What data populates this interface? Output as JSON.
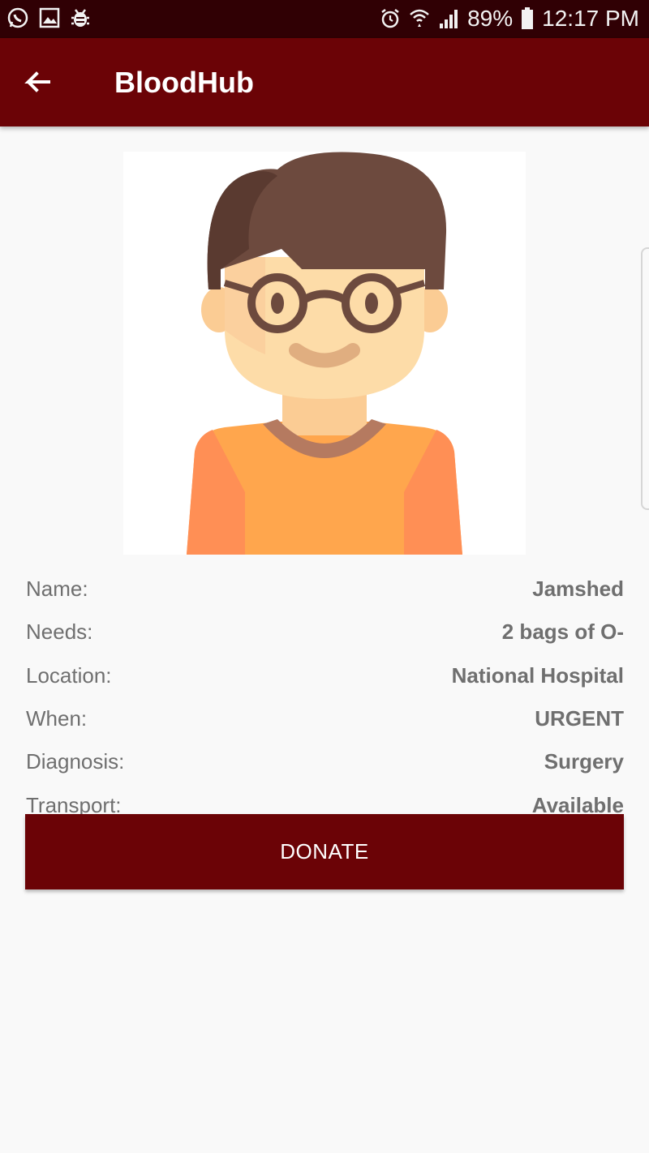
{
  "status_bar": {
    "battery": "89%",
    "time": "12:17 PM",
    "left_icons": [
      "whatsapp-icon",
      "gallery-icon",
      "debug-icon"
    ],
    "right_icons": [
      "alarm-icon",
      "wifi-icon",
      "signal-icon",
      "battery-icon"
    ]
  },
  "app_bar": {
    "title": "BloodHub",
    "back_icon": "arrow-left-icon"
  },
  "avatar": {
    "icon": "user-avatar-glasses",
    "colors": {
      "hair": "#6d4a3e",
      "skin": "#fddca8",
      "shirt": "#ffa64d",
      "collar": "#b57a60"
    }
  },
  "details": {
    "rows": [
      {
        "label": "Name:",
        "value": "Jamshed"
      },
      {
        "label": "Needs:",
        "value": "2 bags of O-"
      },
      {
        "label": "Location:",
        "value": "National Hospital"
      },
      {
        "label": "When:",
        "value": "URGENT"
      },
      {
        "label": "Diagnosis:",
        "value": "Surgery"
      },
      {
        "label": "Transport:",
        "value": "Available"
      }
    ]
  },
  "actions": {
    "donate_label": "DONATE"
  },
  "theme": {
    "primary": "#6b0306",
    "status_bar": "#300004",
    "background": "#f9f9f9",
    "text_muted": "#6f6f6f"
  }
}
